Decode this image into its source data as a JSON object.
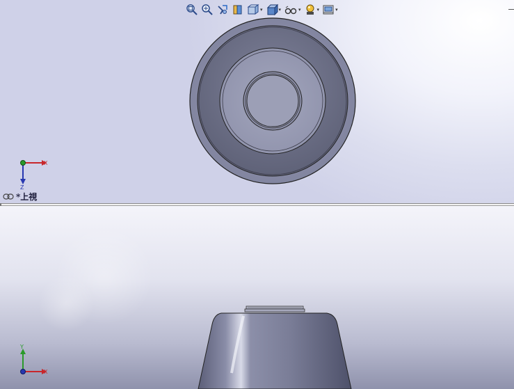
{
  "toolbar": {
    "items": [
      {
        "name": "zoom-to-fit",
        "has_dropdown": false
      },
      {
        "name": "zoom-to-area",
        "has_dropdown": false
      },
      {
        "name": "previous-view",
        "has_dropdown": false
      },
      {
        "name": "section-view",
        "has_dropdown": false
      },
      {
        "name": "view-orientation",
        "has_dropdown": true
      },
      {
        "name": "display-style",
        "has_dropdown": true
      },
      {
        "name": "hide-show-items",
        "has_dropdown": true
      },
      {
        "name": "edit-appearance",
        "has_dropdown": true
      },
      {
        "name": "apply-scene",
        "has_dropdown": true
      },
      {
        "name": "view-settings",
        "has_dropdown": true
      }
    ],
    "caret_glyph": "▾"
  },
  "top_viewport": {
    "view_name": "*上視",
    "triad": {
      "axis_h": "X",
      "axis_v": "Z"
    }
  },
  "bottom_viewport": {
    "triad": {
      "axis_h": "X",
      "axis_v": "Y"
    }
  },
  "colors": {
    "axis_x": "#c8262b",
    "axis_y": "#2a9a2a",
    "axis_z": "#2737b0",
    "model_body": "#8a8da6",
    "model_outline": "#222233"
  }
}
